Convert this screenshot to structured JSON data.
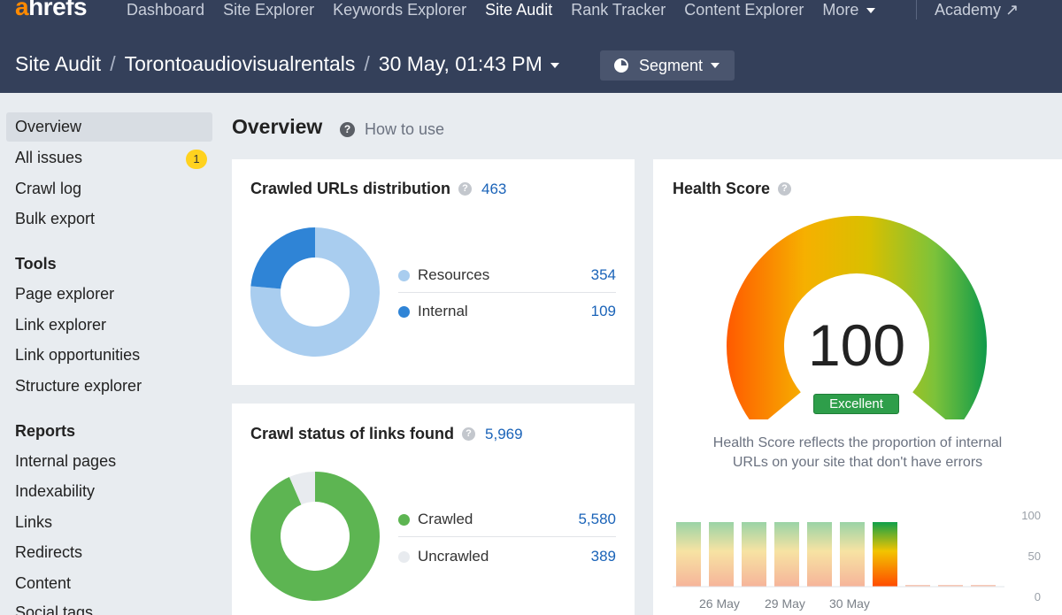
{
  "nav": {
    "logo_a": "a",
    "logo_rest": "hrefs",
    "links": [
      "Dashboard",
      "Site Explorer",
      "Keywords Explorer",
      "Site Audit",
      "Rank Tracker",
      "Content Explorer",
      "More"
    ],
    "active": "Site Audit",
    "academy": "Academy ↗"
  },
  "breadcrumb": {
    "root": "Site Audit",
    "project": "Torontoaudiovisualrentals",
    "crawl": "30 May, 01:43 PM",
    "segment_label": "Segment"
  },
  "sidebar": {
    "top": [
      "Overview",
      "All issues",
      "Crawl log",
      "Bulk export"
    ],
    "issues_badge": "1",
    "tools_heading": "Tools",
    "tools": [
      "Page explorer",
      "Link explorer",
      "Link opportunities",
      "Structure explorer"
    ],
    "reports_heading": "Reports",
    "reports": [
      "Internal pages",
      "Indexability",
      "Links",
      "Redirects",
      "Content",
      "Social tags"
    ]
  },
  "main": {
    "title": "Overview",
    "how_to_use": "How to use",
    "help_glyph": "?"
  },
  "crawled_urls": {
    "title": "Crawled URLs distribution",
    "total": "463",
    "legend": [
      {
        "label": "Resources",
        "value": "354",
        "color": "#a9cdef"
      },
      {
        "label": "Internal",
        "value": "109",
        "color": "#2f84d6"
      }
    ]
  },
  "crawl_status": {
    "title": "Crawl status of links found",
    "total": "5,969",
    "legend": [
      {
        "label": "Crawled",
        "value": "5,580",
        "color": "#5db552"
      },
      {
        "label": "Uncrawled",
        "value": "389",
        "color": "#e8ebef"
      }
    ]
  },
  "health_score": {
    "title": "Health Score",
    "score": "100",
    "rating": "Excellent",
    "description_line1": "Health Score reflects the proportion of internal",
    "description_line2": "URLs on your site that don't have errors",
    "chart_data": {
      "type": "bar",
      "values": [
        100,
        100,
        100,
        100,
        100,
        100,
        100,
        0,
        0,
        0
      ],
      "highlighted_index": 6,
      "yticks": [
        "100",
        "50",
        "0"
      ],
      "ylim": [
        0,
        100
      ],
      "xticks": [
        "26 May",
        "29 May",
        "30 May"
      ]
    }
  }
}
